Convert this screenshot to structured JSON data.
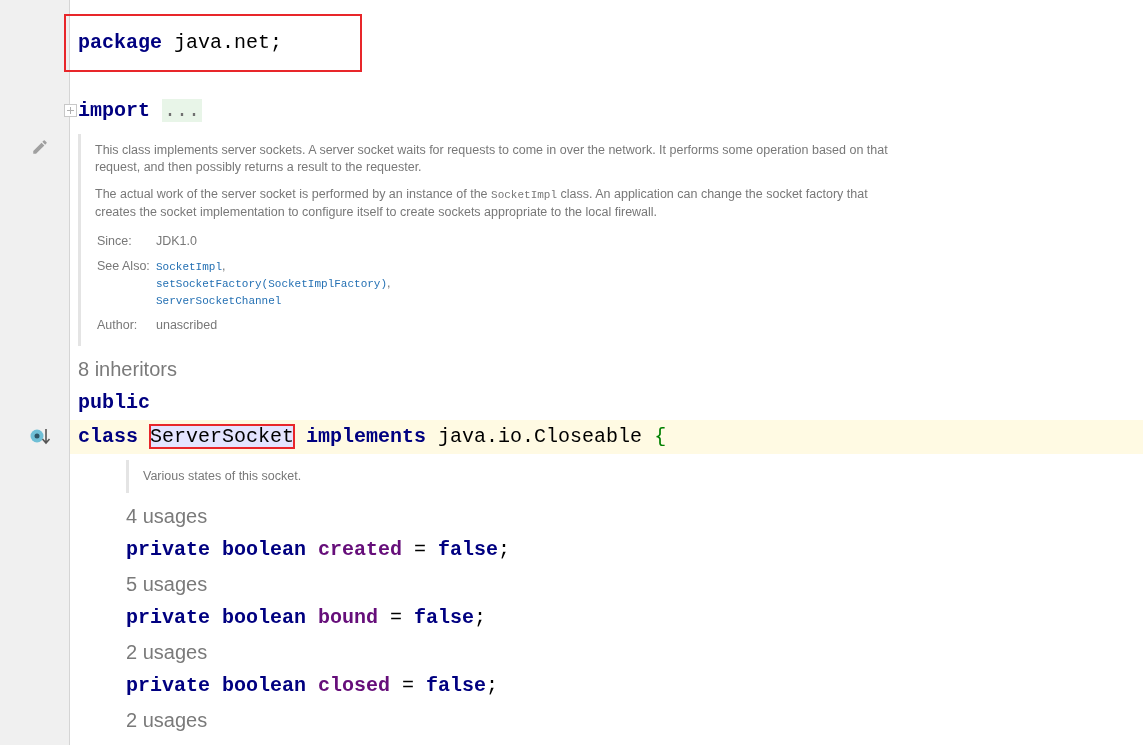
{
  "lines": [
    {
      "kind": "code",
      "current": false,
      "boxed": true,
      "tokens": [
        {
          "kind": "keyword",
          "text": "package "
        },
        {
          "kind": "plain",
          "text": "java.net;"
        }
      ]
    },
    {
      "kind": "blank"
    },
    {
      "kind": "code",
      "current": false,
      "boxed": false,
      "fold": true,
      "tokens": [
        {
          "kind": "keyword",
          "text": "import "
        },
        {
          "kind": "folded",
          "text": "..."
        }
      ]
    },
    {
      "kind": "doc",
      "edit_marker": true,
      "paragraphs": [
        [
          {
            "kind": "text",
            "text": "This class implements server sockets. A server socket waits for requests to come in over the network. It performs some operation based on that request, and then possibly returns a result to the requester."
          }
        ],
        [
          {
            "kind": "text",
            "text": "The actual work of the server socket is performed by an instance of the "
          },
          {
            "kind": "code",
            "text": "SocketImpl"
          },
          {
            "kind": "text",
            "text": " class. An application can change the socket factory that creates the socket implementation to configure itself to create sockets appropriate to the local firewall."
          }
        ]
      ],
      "tags": [
        {
          "label": "Since:",
          "values": [
            [
              {
                "kind": "text",
                "text": "JDK1.0"
              }
            ]
          ]
        },
        {
          "label": "See Also:",
          "values": [
            [
              {
                "kind": "link",
                "text": "SocketImpl"
              },
              {
                "kind": "text",
                "text": ","
              }
            ],
            [
              {
                "kind": "link",
                "text": "setSocketFactory(SocketImplFactory)"
              },
              {
                "kind": "text",
                "text": ","
              }
            ],
            [
              {
                "kind": "link",
                "text": "ServerSocketChannel"
              }
            ]
          ]
        },
        {
          "label": "Author:",
          "values": [
            [
              {
                "kind": "text",
                "text": "unascribed"
              }
            ]
          ]
        }
      ]
    },
    {
      "kind": "hint",
      "text": "8 inheritors"
    },
    {
      "kind": "code",
      "current": false,
      "boxed": false,
      "tokens": [
        {
          "kind": "keyword",
          "text": "public"
        }
      ]
    },
    {
      "kind": "code",
      "current": true,
      "boxed": false,
      "implements_marker": true,
      "tokens": [
        {
          "kind": "keyword",
          "text": "class "
        },
        {
          "kind": "plain",
          "text": "ServerSocket",
          "highlighted": true,
          "boxed": true
        },
        {
          "kind": "keyword",
          "text": " implements "
        },
        {
          "kind": "plain",
          "text": "java.io.Closeable "
        },
        {
          "kind": "brace",
          "text": "{"
        }
      ],
      "children": [
        {
          "kind": "doc",
          "paragraphs": [
            [
              {
                "kind": "text",
                "text": "Various states of this socket."
              }
            ]
          ]
        },
        {
          "kind": "hint",
          "text": "4 usages"
        },
        {
          "kind": "code",
          "current": false,
          "boxed": false,
          "tokens": [
            {
              "kind": "keyword",
              "text": "private boolean "
            },
            {
              "kind": "field",
              "text": "created"
            },
            {
              "kind": "plain",
              "text": " = "
            },
            {
              "kind": "keyword",
              "text": "false"
            },
            {
              "kind": "plain",
              "text": ";"
            }
          ]
        },
        {
          "kind": "hint",
          "text": "5 usages"
        },
        {
          "kind": "code",
          "current": false,
          "boxed": false,
          "tokens": [
            {
              "kind": "keyword",
              "text": "private boolean "
            },
            {
              "kind": "field",
              "text": "bound"
            },
            {
              "kind": "plain",
              "text": " = "
            },
            {
              "kind": "keyword",
              "text": "false"
            },
            {
              "kind": "plain",
              "text": ";"
            }
          ]
        },
        {
          "kind": "hint",
          "text": "2 usages"
        },
        {
          "kind": "code",
          "current": false,
          "boxed": false,
          "tokens": [
            {
              "kind": "keyword",
              "text": "private boolean "
            },
            {
              "kind": "field",
              "text": "closed"
            },
            {
              "kind": "plain",
              "text": " = "
            },
            {
              "kind": "keyword",
              "text": "false"
            },
            {
              "kind": "plain",
              "text": ";"
            }
          ]
        },
        {
          "kind": "hint",
          "text": "2 usages"
        }
      ]
    }
  ]
}
